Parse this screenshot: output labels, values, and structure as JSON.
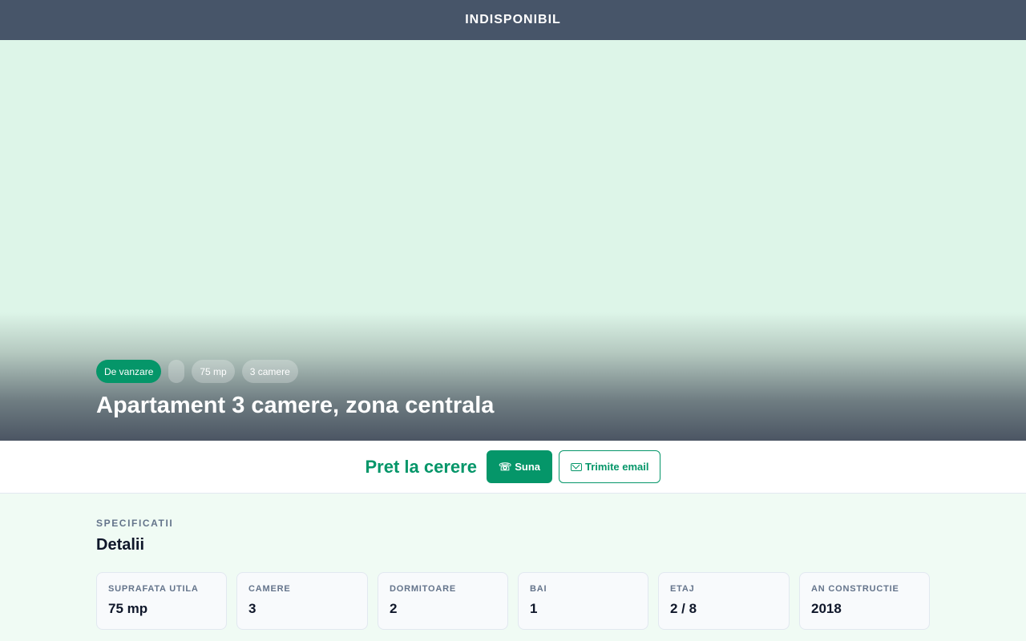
{
  "topbar": {
    "title": "INDISPONIBIL"
  },
  "hero": {
    "badges": [
      {
        "label": "De vanzare",
        "kind": "primary"
      },
      {
        "label": "",
        "kind": "empty"
      },
      {
        "label": "75 mp",
        "kind": "muted"
      },
      {
        "label": "3 camere",
        "kind": "muted"
      }
    ],
    "title": "Apartament 3 camere, zona centrala"
  },
  "pricebar": {
    "price": "Pret la cerere",
    "call_icon": "phone-icon",
    "call_label": "Suna",
    "email_icon": "mail-icon",
    "email_label": "Trimite email"
  },
  "details": {
    "eyebrow": "SPECIFICATII",
    "title": "Detalii",
    "specs": [
      {
        "label": "SUPRAFATA UTILA",
        "value": "75 mp"
      },
      {
        "label": "CAMERE",
        "value": "3"
      },
      {
        "label": "DORMITOARE",
        "value": "2"
      },
      {
        "label": "BAI",
        "value": "1"
      },
      {
        "label": "ETAJ",
        "value": "2 / 8"
      },
      {
        "label": "AN CONSTRUCTIE",
        "value": "2018"
      }
    ]
  },
  "colors": {
    "accent": "#059669",
    "topbar": "#475569",
    "hero_bg": "#ddf5e8"
  }
}
